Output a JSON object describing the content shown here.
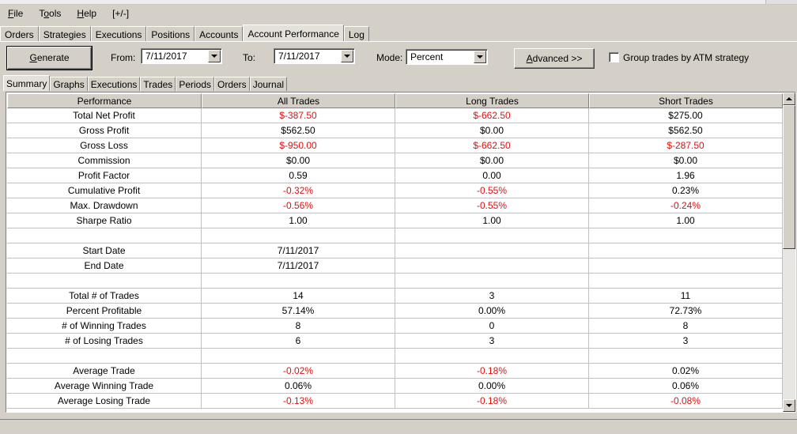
{
  "menu": [
    {
      "pre": "",
      "u": "F",
      "post": "ile"
    },
    {
      "pre": "T",
      "u": "o",
      "post": "ols"
    },
    {
      "pre": "",
      "u": "H",
      "post": "elp"
    },
    {
      "pre": "[+/-]",
      "u": "",
      "post": ""
    }
  ],
  "tabs": [
    "Orders",
    "Strategies",
    "Executions",
    "Positions",
    "Accounts",
    "Account Performance",
    "Log"
  ],
  "active_tab": 5,
  "toolbar": {
    "generate_pre": "",
    "generate_u": "G",
    "generate_post": "enerate",
    "from_label": "From:",
    "from_value": "7/11/2017",
    "to_label": "To:",
    "to_value": "7/11/2017",
    "mode_label": "Mode:",
    "mode_value": "Percent",
    "advanced_u": "A",
    "advanced_post": "dvanced >>",
    "group_label": "Group trades by ATM strategy"
  },
  "subtabs": [
    "Summary",
    "Graphs",
    "Executions",
    "Trades",
    "Periods",
    "Orders",
    "Journal"
  ],
  "active_subtab": 0,
  "colors": {
    "negative": "#e01010"
  },
  "table": {
    "headers": [
      "Performance",
      "All Trades",
      "Long Trades",
      "Short Trades"
    ],
    "rows": [
      [
        "Total Net Profit",
        "$-387.50",
        "$-662.50",
        "$275.00"
      ],
      [
        "Gross Profit",
        "$562.50",
        "$0.00",
        "$562.50"
      ],
      [
        "Gross Loss",
        "$-950.00",
        "$-662.50",
        "$-287.50"
      ],
      [
        "Commission",
        "$0.00",
        "$0.00",
        "$0.00"
      ],
      [
        "Profit Factor",
        "0.59",
        "0.00",
        "1.96"
      ],
      [
        "Cumulative Profit",
        "-0.32%",
        "-0.55%",
        "0.23%"
      ],
      [
        "Max. Drawdown",
        "-0.56%",
        "-0.55%",
        "-0.24%"
      ],
      [
        "Sharpe Ratio",
        "1.00",
        "1.00",
        "1.00"
      ],
      [
        "",
        "",
        "",
        ""
      ],
      [
        "Start Date",
        "7/11/2017",
        "",
        ""
      ],
      [
        "End Date",
        "7/11/2017",
        "",
        ""
      ],
      [
        "",
        "",
        "",
        ""
      ],
      [
        "Total # of Trades",
        "14",
        "3",
        "11"
      ],
      [
        "Percent Profitable",
        "57.14%",
        "0.00%",
        "72.73%"
      ],
      [
        "# of Winning Trades",
        "8",
        "0",
        "8"
      ],
      [
        "# of Losing Trades",
        "6",
        "3",
        "3"
      ],
      [
        "",
        "",
        "",
        ""
      ],
      [
        "Average Trade",
        "-0.02%",
        "-0.18%",
        "0.02%"
      ],
      [
        "Average Winning Trade",
        "0.06%",
        "0.00%",
        "0.06%"
      ],
      [
        "Average Losing Trade",
        "-0.13%",
        "-0.18%",
        "-0.08%"
      ]
    ]
  }
}
